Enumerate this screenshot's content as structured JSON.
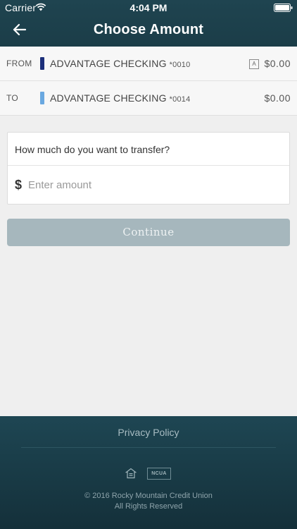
{
  "status_bar": {
    "carrier": "Carrier",
    "time": "4:04 PM",
    "wifi_icon": "wifi-icon",
    "battery_icon": "battery-icon"
  },
  "header": {
    "title": "Choose Amount",
    "back_icon": "back-arrow-icon"
  },
  "accounts": {
    "from": {
      "label": "FROM",
      "name": "ADVANTAGE CHECKING",
      "number": "*0010",
      "badge": "A",
      "balance": "$0.00",
      "color": "#1c2f7a"
    },
    "to": {
      "label": "TO",
      "name": "ADVANTAGE CHECKING",
      "number": "*0014",
      "balance": "$0.00",
      "color": "#6aa8e0"
    }
  },
  "amount": {
    "question": "How much do you want to transfer?",
    "currency_symbol": "$",
    "placeholder": "Enter amount",
    "value": ""
  },
  "continue_label": "Continue",
  "footer": {
    "privacy_link": "Privacy Policy",
    "equal_housing_icon": "equal-housing-icon",
    "ncua_logo": "NCUA",
    "copyright": "© 2016 Rocky Mountain Credit Union",
    "rights": "All Rights Reserved"
  },
  "colors": {
    "header_bg": "#1f4450",
    "button_disabled": "#a6b7bd",
    "background": "#efefef"
  }
}
